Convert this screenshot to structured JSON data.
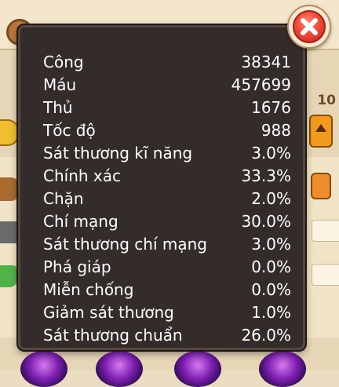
{
  "stats": [
    {
      "label": "Công",
      "value": "38341"
    },
    {
      "label": "Máu",
      "value": "457699"
    },
    {
      "label": "Thủ",
      "value": "1676"
    },
    {
      "label": "Tốc độ",
      "value": "988"
    },
    {
      "label": "Sát thương kĩ năng",
      "value": "3.0%"
    },
    {
      "label": "Chính xác",
      "value": "33.3%"
    },
    {
      "label": "Chặn",
      "value": "2.0%"
    },
    {
      "label": "Chí mạng",
      "value": "30.0%"
    },
    {
      "label": "Sát thương chí mạng",
      "value": "3.0%"
    },
    {
      "label": "Phá giáp",
      "value": "0.0%"
    },
    {
      "label": "Miễn chống",
      "value": "0.0%"
    },
    {
      "label": "Giảm sát thương",
      "value": "1.0%"
    },
    {
      "label": "Sát thương chuẩn",
      "value": "26.0%"
    }
  ],
  "background": {
    "level_text": "10"
  },
  "icons": {
    "close": "close-icon"
  },
  "colors": {
    "panel_bg": "#342c2a",
    "text": "#ffffff",
    "close_red": "#ef4b3a"
  }
}
